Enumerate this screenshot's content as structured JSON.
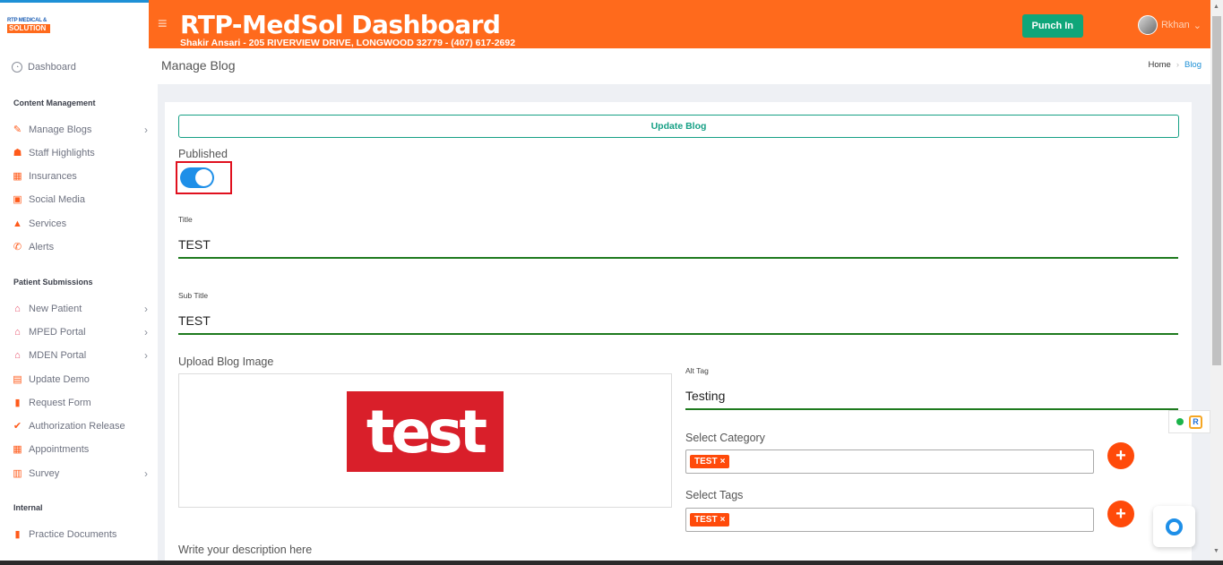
{
  "header": {
    "logo_top": "RTP MEDICAL &",
    "logo_bottom": "SOLUTION",
    "title": "RTP-MedSol Dashboard",
    "address": "Shakir Ansari - 205 RIVERVIEW DRIVE, LONGWOOD 32779 - (407) 617-2692",
    "punch_label": "Punch In",
    "user_name": "Rkhan",
    "user_chevron": "⌄"
  },
  "sidebar": {
    "dashboard": "Dashboard",
    "section_content": "Content Management",
    "content_items": [
      {
        "label": "Manage Blogs",
        "chevron": "›"
      },
      {
        "label": "Staff Highlights"
      },
      {
        "label": "Insurances"
      },
      {
        "label": "Social Media"
      },
      {
        "label": "Services"
      },
      {
        "label": "Alerts"
      }
    ],
    "section_patient": "Patient Submissions",
    "patient_items": [
      {
        "label": "New Patient",
        "chevron": "›"
      },
      {
        "label": "MPED Portal",
        "chevron": "›"
      },
      {
        "label": "MDEN Portal",
        "chevron": "›"
      },
      {
        "label": "Update Demo"
      },
      {
        "label": "Request Form"
      },
      {
        "label": "Authorization Release"
      },
      {
        "label": "Appointments"
      },
      {
        "label": "Survey",
        "chevron": "›"
      }
    ],
    "section_internal": "Internal",
    "internal_items": [
      {
        "label": "Practice Documents"
      }
    ]
  },
  "page": {
    "title": "Manage Blog",
    "breadcrumb_home": "Home",
    "breadcrumb_sep": "›",
    "breadcrumb_current": "Blog"
  },
  "form": {
    "update_label": "Update Blog",
    "published_label": "Published",
    "published": true,
    "title_label": "Title",
    "title_value": "TEST",
    "subtitle_label": "Sub Title",
    "subtitle_value": "TEST",
    "upload_label": "Upload Blog Image",
    "image_text": "test",
    "alt_label": "Alt Tag",
    "alt_value": "Testing",
    "category_label": "Select Category",
    "category_chip": "TEST",
    "tags_label": "Select Tags",
    "tag_chip": "TEST",
    "chip_remove": "×",
    "add_symbol": "+",
    "description_label": "Write your description here"
  },
  "widgets": {
    "ext_letter": "R"
  },
  "colors": {
    "brand_orange": "#ff6a1c",
    "accent_green": "#0fa679",
    "toggle_blue": "#1e8fe8",
    "highlight_red": "#e0101e"
  },
  "icons": {
    "menu": "hamburger-icon",
    "dashboard": "speedometer-icon"
  }
}
